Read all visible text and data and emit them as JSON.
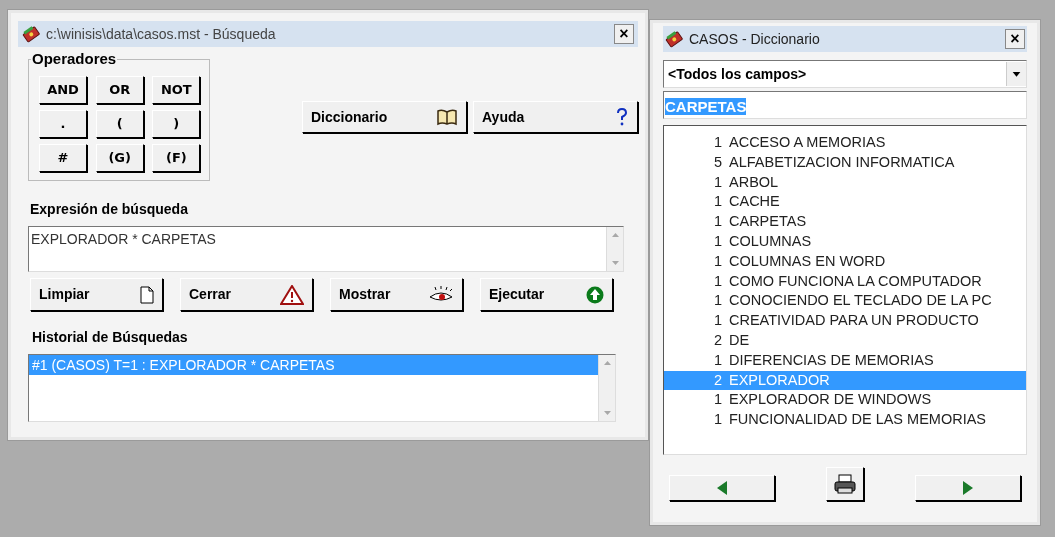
{
  "search_window": {
    "title": "c:\\winisis\\data\\casos.mst - Búsqueda",
    "close": "×",
    "operators": {
      "title": "Operadores",
      "buttons": [
        "AND",
        "OR",
        "NOT",
        ".",
        "(",
        ")",
        "#",
        "(G)",
        "(F)"
      ]
    },
    "top_buttons": [
      {
        "label": "Diccionario",
        "kind": "book"
      },
      {
        "label": "Ayuda",
        "kind": "help"
      }
    ],
    "expression": {
      "label": "Expresión de búsqueda",
      "value": "EXPLORADOR * CARPETAS"
    },
    "actions": [
      {
        "label": "Limpiar",
        "kind": "page"
      },
      {
        "label": "Cerrar",
        "kind": "warning"
      },
      {
        "label": "Mostrar",
        "kind": "eye"
      },
      {
        "label": "Ejecutar",
        "kind": "run"
      }
    ],
    "history": {
      "label": "Historial de Búsquedas",
      "items": [
        {
          "text": "#1 (CASOS) T=1 : EXPLORADOR  * CARPETAS",
          "selected": true
        }
      ]
    }
  },
  "dictionary_window": {
    "title": "CASOS - Diccionario",
    "close": "×",
    "field_select": "<Todos los campos>",
    "term": "CARPETAS",
    "terms": [
      {
        "count": "1",
        "term": "ACCESO A MEMORIAS",
        "selected": false
      },
      {
        "count": "5",
        "term": "ALFABETIZACION INFORMATICA",
        "selected": false
      },
      {
        "count": "1",
        "term": "ARBOL",
        "selected": false
      },
      {
        "count": "1",
        "term": "CACHE",
        "selected": false
      },
      {
        "count": "1",
        "term": "CARPETAS",
        "selected": false
      },
      {
        "count": "1",
        "term": "COLUMNAS",
        "selected": false
      },
      {
        "count": "1",
        "term": "COLUMNAS EN WORD",
        "selected": false
      },
      {
        "count": "1",
        "term": "COMO FUNCIONA LA COMPUTADOR",
        "selected": false
      },
      {
        "count": "1",
        "term": "CONOCIENDO EL TECLADO DE LA PC",
        "selected": false
      },
      {
        "count": "1",
        "term": "CREATIVIDAD PARA UN PRODUCTO",
        "selected": false
      },
      {
        "count": "2",
        "term": "DE",
        "selected": false
      },
      {
        "count": "1",
        "term": "DIFERENCIAS DE MEMORIAS",
        "selected": false
      },
      {
        "count": "2",
        "term": "EXPLORADOR",
        "selected": true
      },
      {
        "count": "1",
        "term": "EXPLORADOR DE WINDOWS",
        "selected": false
      },
      {
        "count": "1",
        "term": "FUNCIONALIDAD DE LAS MEMORIAS",
        "selected": false
      }
    ]
  }
}
